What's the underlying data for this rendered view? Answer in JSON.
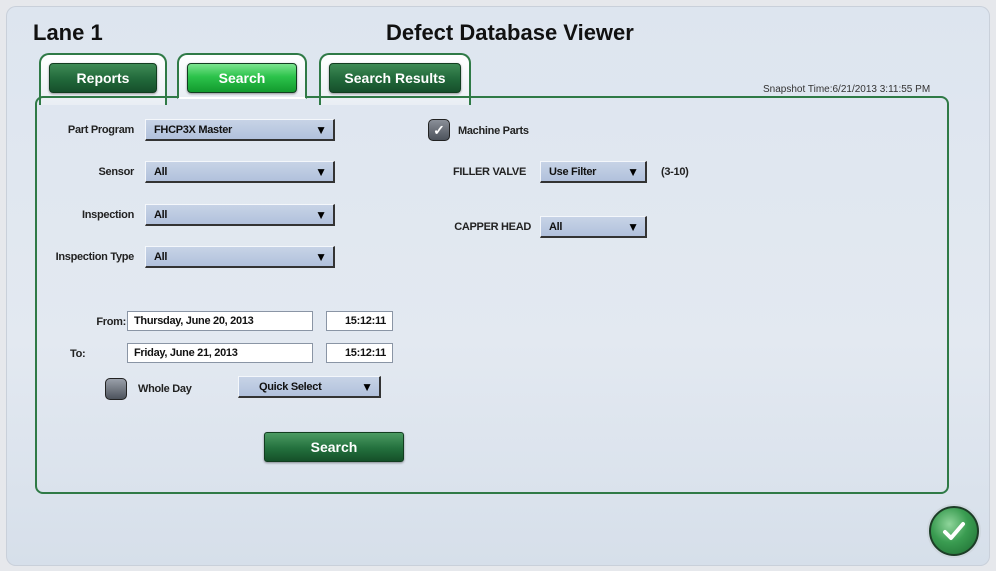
{
  "header": {
    "lane": "Lane 1",
    "title": "Defect Database Viewer"
  },
  "tabs": [
    {
      "label": "Reports"
    },
    {
      "label": "Search"
    },
    {
      "label": "Search Results"
    }
  ],
  "snapshot": "Snapshot Time:6/21/2013 3:11:55 PM",
  "filters": {
    "part_program": {
      "label": "Part Program",
      "value": "FHCP3X Master"
    },
    "sensor": {
      "label": "Sensor",
      "value": "All"
    },
    "inspection": {
      "label": "Inspection",
      "value": "All"
    },
    "inspection_type": {
      "label": "Inspection Type",
      "value": "All"
    }
  },
  "machine_parts": {
    "label": "Machine Parts",
    "checked": true,
    "filler_valve": {
      "label": "FILLER VALVE",
      "value": "Use Filter",
      "range": "(3-10)"
    },
    "capper_head": {
      "label": "CAPPER HEAD",
      "value": "All"
    }
  },
  "date_range": {
    "from_label": "From:",
    "from_date": "Thursday, June 20, 2013",
    "from_time": "15:12:11",
    "to_label": "To:",
    "to_date": "Friday, June 21, 2013",
    "to_time": "15:12:11",
    "whole_day_label": "Whole Day",
    "quick_select": "Quick Select"
  },
  "search_button": "Search",
  "icons": {
    "dropdown": "chevron-down-icon",
    "check": "checkmark-icon",
    "ok": "checkmark-icon"
  }
}
